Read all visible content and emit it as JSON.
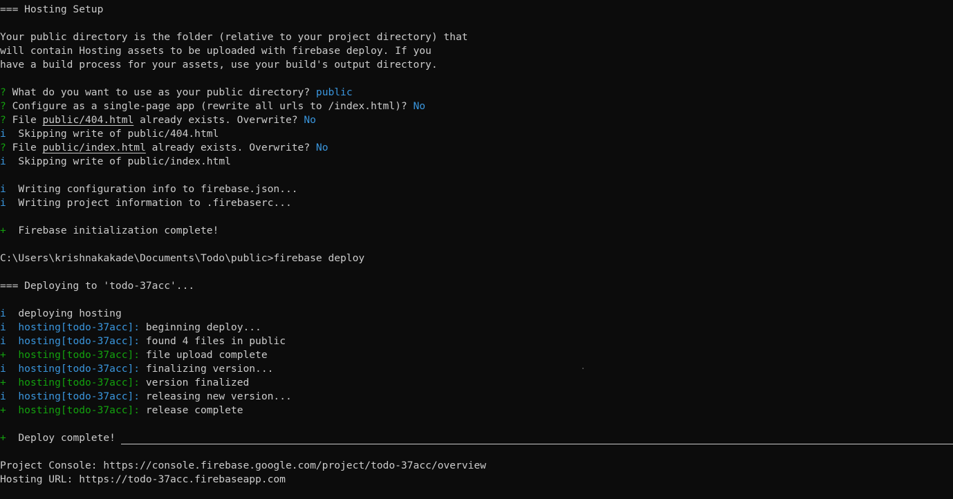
{
  "terminal": {
    "lines": [
      [
        {
          "t": "=== Hosting Setup",
          "c": "default"
        }
      ],
      [],
      [
        {
          "t": "Your public directory is the folder (relative to your project directory) that",
          "c": "default"
        }
      ],
      [
        {
          "t": "will contain Hosting assets to be uploaded with firebase deploy. If you",
          "c": "default"
        }
      ],
      [
        {
          "t": "have a build process for your assets, use your build's output directory.",
          "c": "default"
        }
      ],
      [],
      [
        {
          "t": "?",
          "c": "green"
        },
        {
          "t": " What do you want to use as your public directory? ",
          "c": "default"
        },
        {
          "t": "public",
          "c": "ans"
        }
      ],
      [
        {
          "t": "?",
          "c": "green"
        },
        {
          "t": " Configure as a single-page app (rewrite all urls to /index.html)? ",
          "c": "default"
        },
        {
          "t": "No",
          "c": "ans"
        }
      ],
      [
        {
          "t": "?",
          "c": "green"
        },
        {
          "t": " File ",
          "c": "default"
        },
        {
          "t": "public/404.html",
          "c": "default",
          "u": true
        },
        {
          "t": " already exists. Overwrite? ",
          "c": "default"
        },
        {
          "t": "No",
          "c": "ans"
        }
      ],
      [
        {
          "t": "i",
          "c": "cyan"
        },
        {
          "t": "  Skipping write of public/404.html",
          "c": "default"
        }
      ],
      [
        {
          "t": "?",
          "c": "green"
        },
        {
          "t": " File ",
          "c": "default"
        },
        {
          "t": "public/index.html",
          "c": "default",
          "u": true
        },
        {
          "t": " already exists. Overwrite? ",
          "c": "default"
        },
        {
          "t": "No",
          "c": "ans"
        }
      ],
      [
        {
          "t": "i",
          "c": "cyan"
        },
        {
          "t": "  Skipping write of public/index.html",
          "c": "default"
        }
      ],
      [],
      [
        {
          "t": "i",
          "c": "cyan"
        },
        {
          "t": "  Writing configuration info to firebase.json...",
          "c": "default"
        }
      ],
      [
        {
          "t": "i",
          "c": "cyan"
        },
        {
          "t": "  Writing project information to .firebaserc...",
          "c": "default"
        }
      ],
      [],
      [
        {
          "t": "+",
          "c": "green"
        },
        {
          "t": "  Firebase initialization complete!",
          "c": "default"
        }
      ],
      [],
      [
        {
          "t": "C:\\Users\\krishnakakade\\Documents\\Todo\\public>firebase deploy",
          "c": "default"
        }
      ],
      [],
      [
        {
          "t": "=== Deploying to 'todo-37acc'...",
          "c": "default"
        }
      ],
      [],
      [
        {
          "t": "i",
          "c": "cyan"
        },
        {
          "t": "  deploying hosting",
          "c": "default"
        }
      ],
      [
        {
          "t": "i",
          "c": "cyan"
        },
        {
          "t": "  ",
          "c": "default"
        },
        {
          "t": "hosting[todo-37acc]:",
          "c": "cyan"
        },
        {
          "t": " beginning deploy...",
          "c": "default"
        }
      ],
      [
        {
          "t": "i",
          "c": "cyan"
        },
        {
          "t": "  ",
          "c": "default"
        },
        {
          "t": "hosting[todo-37acc]:",
          "c": "cyan"
        },
        {
          "t": " found 4 files in public",
          "c": "default"
        }
      ],
      [
        {
          "t": "+",
          "c": "green"
        },
        {
          "t": "  ",
          "c": "default"
        },
        {
          "t": "hosting[todo-37acc]:",
          "c": "green"
        },
        {
          "t": " file upload complete",
          "c": "default"
        }
      ],
      [
        {
          "t": "i",
          "c": "cyan"
        },
        {
          "t": "  ",
          "c": "default"
        },
        {
          "t": "hosting[todo-37acc]:",
          "c": "cyan"
        },
        {
          "t": " finalizing version...",
          "c": "default"
        }
      ],
      [
        {
          "t": "+",
          "c": "green"
        },
        {
          "t": "  ",
          "c": "default"
        },
        {
          "t": "hosting[todo-37acc]:",
          "c": "green"
        },
        {
          "t": " version finalized",
          "c": "default"
        }
      ],
      [
        {
          "t": "i",
          "c": "cyan"
        },
        {
          "t": "  ",
          "c": "default"
        },
        {
          "t": "hosting[todo-37acc]:",
          "c": "cyan"
        },
        {
          "t": " releasing new version...",
          "c": "default"
        }
      ],
      [
        {
          "t": "+",
          "c": "green"
        },
        {
          "t": "  ",
          "c": "default"
        },
        {
          "t": "hosting[todo-37acc]:",
          "c": "green"
        },
        {
          "t": " release complete",
          "c": "default"
        }
      ],
      [],
      [
        {
          "t": "+",
          "c": "green"
        },
        {
          "t": "  Deploy complete!",
          "c": "default"
        }
      ],
      [],
      [
        {
          "t": "Project Console: https://console.firebase.google.com/project/todo-37acc/overview",
          "c": "default"
        }
      ],
      [
        {
          "t": "Hosting URL: https://todo-37acc.firebaseapp.com",
          "c": "default"
        }
      ]
    ]
  },
  "colors": {
    "background": "#0c0c0c",
    "text": "#cccccc",
    "green": "#13a10e",
    "cyan": "#3a96dd"
  }
}
